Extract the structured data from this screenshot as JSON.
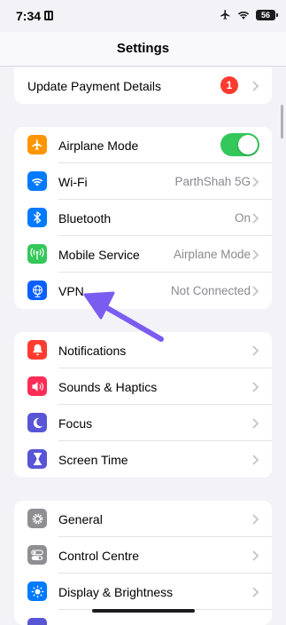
{
  "status_bar": {
    "time": "7:34",
    "battery": "56"
  },
  "nav": {
    "title": "Settings"
  },
  "account": {
    "update_payment_label": "Update Payment Details",
    "update_payment_badge": "1"
  },
  "connectivity": [
    {
      "label": "Airplane Mode",
      "icon": "airplane-icon",
      "color": "#ff9500",
      "toggle_on": true
    },
    {
      "label": "Wi-Fi",
      "value": "ParthShah 5G",
      "icon": "wifi-icon",
      "color": "#007aff"
    },
    {
      "label": "Bluetooth",
      "value": "On",
      "icon": "bluetooth-icon",
      "color": "#007aff"
    },
    {
      "label": "Mobile Service",
      "value": "Airplane Mode",
      "icon": "antenna-icon",
      "color": "#34c759"
    },
    {
      "label": "VPN",
      "value": "Not Connected",
      "icon": "globe-icon",
      "color": "#0a60ff"
    }
  ],
  "notifications_group": [
    {
      "label": "Notifications",
      "icon": "bell-icon",
      "color": "#ff3b30"
    },
    {
      "label": "Sounds & Haptics",
      "icon": "speaker-icon",
      "color": "#ff2d55"
    },
    {
      "label": "Focus",
      "icon": "moon-icon",
      "color": "#5856d6"
    },
    {
      "label": "Screen Time",
      "icon": "hourglass-icon",
      "color": "#5856d6"
    }
  ],
  "general_group": [
    {
      "label": "General",
      "icon": "gear-icon",
      "color": "#8e8e93"
    },
    {
      "label": "Control Centre",
      "icon": "switches-icon",
      "color": "#8e8e93"
    },
    {
      "label": "Display & Brightness",
      "icon": "sun-icon",
      "color": "#007aff"
    }
  ],
  "annotation": {
    "arrow_color": "#7b5cf0"
  }
}
